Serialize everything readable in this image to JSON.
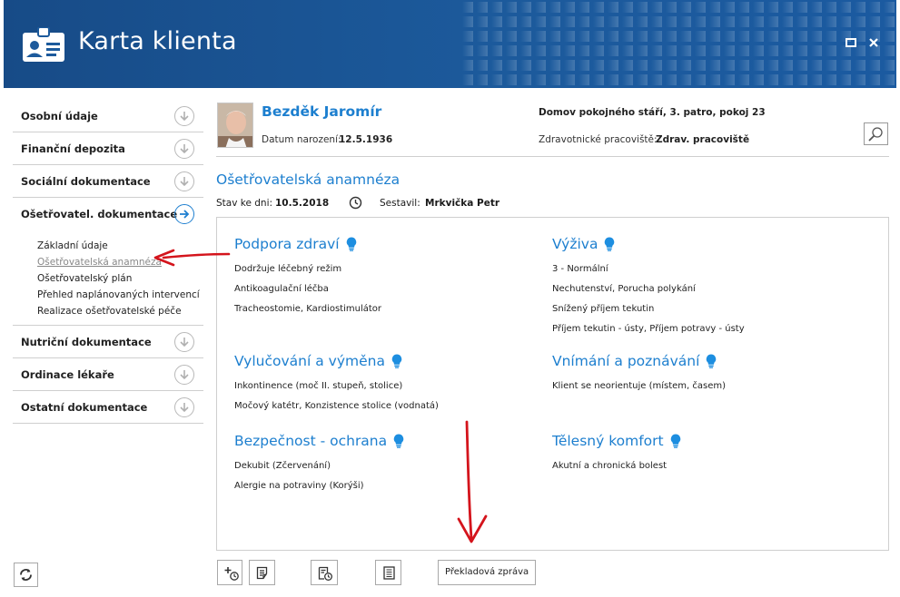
{
  "window": {
    "title": "Karta klienta",
    "maximize_icon": "maximize-icon",
    "close_icon": "close-icon"
  },
  "sidebar": {
    "sections": [
      {
        "label": "Osobní údaje",
        "icon": "arrow-down-circle-icon"
      },
      {
        "label": "Finanční depozita",
        "icon": "arrow-down-circle-icon"
      },
      {
        "label": "Sociální dokumentace",
        "icon": "arrow-down-circle-icon"
      },
      {
        "label": "Ošetřovatel. dokumentace",
        "icon": "arrow-right-circle-icon",
        "expanded": true
      },
      {
        "label": "Nutriční dokumentace",
        "icon": "arrow-down-circle-icon"
      },
      {
        "label": "Ordinace lékaře",
        "icon": "arrow-down-circle-icon"
      },
      {
        "label": "Ostatní dokumentace",
        "icon": "arrow-down-circle-icon"
      }
    ],
    "subitems": [
      "Základní údaje",
      "Ošetřovatelská anamnéza",
      "Ošetřovatelský plán",
      "Přehled naplánovaných intervencí",
      "Realizace ošetřovatelské péče"
    ],
    "current_subitem": "Ošetřovatelská anamnéza"
  },
  "patient": {
    "name": "Bezděk Jaromír",
    "dob_label": "Datum narození:",
    "dob": "12.5.1936",
    "facility": "Domov pokojného stáří, 3. patro, pokoj 23",
    "workplace_label": "Zdravotnické pracoviště:",
    "workplace": "Zdrav. pracoviště"
  },
  "anamnesis": {
    "title": "Ošetřovatelská anamnéza",
    "state_label": "Stav ke dni:",
    "state_date": "10.5.2018",
    "author_label": "Sestavil:",
    "author": "Mrkvička Petr",
    "categories": [
      {
        "title": "Podpora zdraví",
        "items": [
          "Dodržuje léčebný režim",
          "Antikoagulační léčba",
          "Tracheostomie, Kardiostimulátor"
        ]
      },
      {
        "title": "Výživa",
        "items": [
          "3 - Normální",
          "Nechutenství, Porucha polykání",
          "Snížený příjem tekutin",
          "Příjem tekutin - ústy, Příjem potravy - ústy"
        ]
      },
      {
        "title": "Vylučování a výměna",
        "items": [
          "Inkontinence (moč II. stupeň, stolice)",
          "Močový katétr, Konzistence stolice (vodnatá)"
        ]
      },
      {
        "title": "Vnímání a poznávání",
        "items": [
          "Klient se neorientuje (místem, časem)"
        ]
      },
      {
        "title": "Bezpečnost - ochrana",
        "items": [
          "Dekubit (Zčervenání)",
          "Alergie na potraviny (Korýši)"
        ]
      },
      {
        "title": "Tělesný komfort",
        "items": [
          "Akutní a chronická bolest"
        ]
      }
    ]
  },
  "toolbar": {
    "handover_report": "Překladová zpráva"
  },
  "colors": {
    "header_blue": "#1c5a9c",
    "accent_blue": "#1d7fcf",
    "annotation_red": "#d4141c"
  }
}
